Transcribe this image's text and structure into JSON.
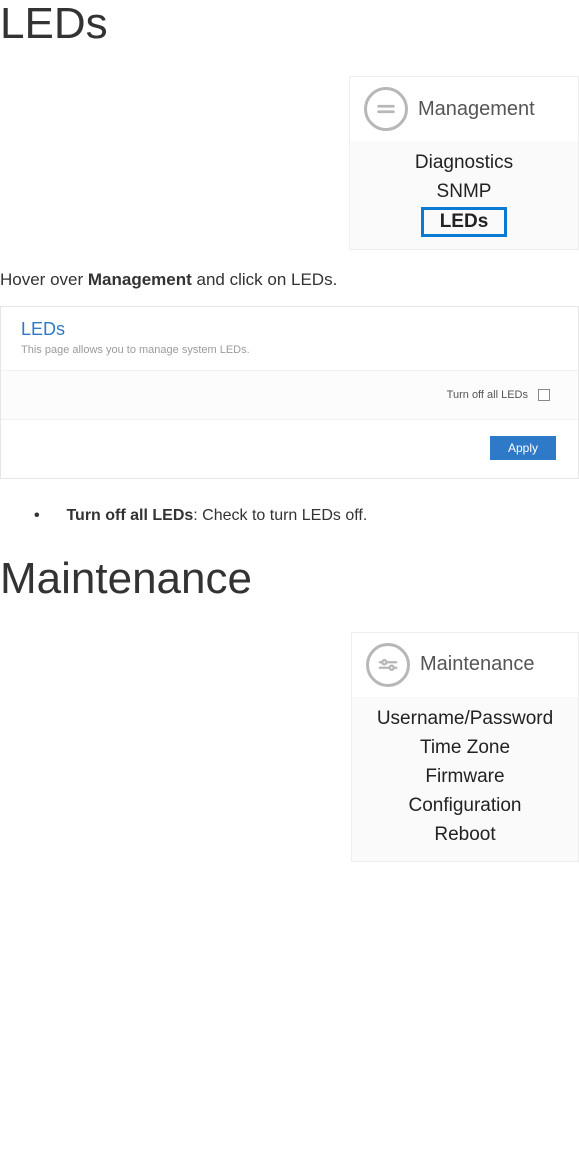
{
  "sections": {
    "leds_title": "LEDs",
    "maintenance_title": "Maintenance"
  },
  "management_menu": {
    "label": "Management",
    "icon": "menu-equals-icon",
    "items": [
      {
        "label": "Diagnostics",
        "selected": false
      },
      {
        "label": "SNMP",
        "selected": false
      },
      {
        "label": "LEDs",
        "selected": true
      }
    ]
  },
  "instruction": {
    "pre": "Hover over ",
    "bold": "Management",
    "post": " and click on LEDs."
  },
  "leds_panel": {
    "title": "LEDs",
    "subtitle": "This page allows you to manage system LEDs.",
    "option_label": "Turn off all LEDs",
    "apply_label": "Apply"
  },
  "bullet": {
    "bold": "Turn off all LEDs",
    "rest": ": Check to turn LEDs off."
  },
  "maintenance_menu": {
    "label": "Maintenance",
    "icon": "sliders-icon",
    "items": [
      {
        "label": "Username/Password"
      },
      {
        "label": "Time Zone"
      },
      {
        "label": "Firmware"
      },
      {
        "label": "Configuration"
      },
      {
        "label": "Reboot"
      }
    ]
  }
}
